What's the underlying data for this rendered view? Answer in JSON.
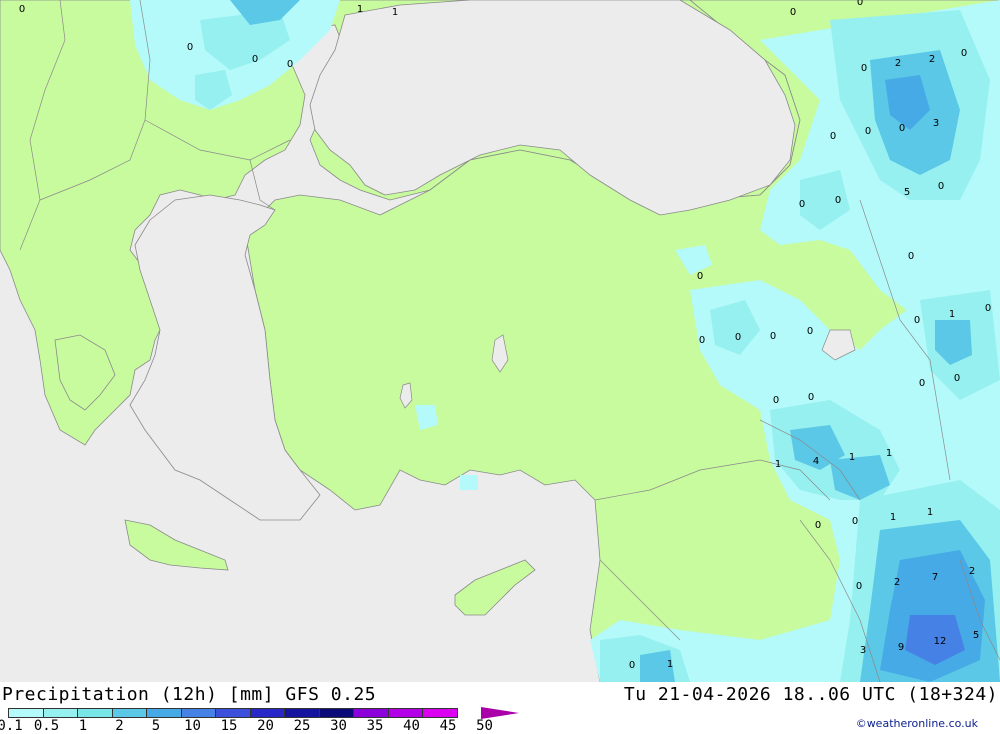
{
  "title": "Precipitation (12h) [mm] GFS 0.25",
  "valid_time": "Tu 21-04-2026 18..06 UTC (18+324)",
  "credit": "©weatheronline.co.uk",
  "colors": {
    "land": "#c8fa9e",
    "sea": "#ececec",
    "border": "#8a8a8a"
  },
  "legend": {
    "labels": [
      "0.1",
      "0.5",
      "1",
      "2",
      "5",
      "10",
      "15",
      "20",
      "25",
      "30",
      "35",
      "40",
      "45",
      "50"
    ],
    "colors": [
      "#b4fafa",
      "#96f0f0",
      "#78e6e6",
      "#5ac8e6",
      "#46aae6",
      "#4682e6",
      "#3c50dc",
      "#2828c8",
      "#1414a0",
      "#0a0a78",
      "#8c00dc",
      "#b400e6",
      "#dc00f0",
      "#aa00aa"
    ]
  },
  "values": [
    {
      "text": "0"
    },
    {
      "text": "1"
    },
    {
      "text": "1"
    },
    {
      "text": "0"
    },
    {
      "text": "0"
    },
    {
      "text": "0"
    },
    {
      "text": "0"
    },
    {
      "text": "0"
    },
    {
      "text": "2"
    },
    {
      "text": "0"
    },
    {
      "text": "0"
    },
    {
      "text": "2"
    },
    {
      "text": "0"
    },
    {
      "text": "0"
    },
    {
      "text": "0"
    },
    {
      "text": "3"
    },
    {
      "text": "5"
    },
    {
      "text": "0"
    },
    {
      "text": "0"
    },
    {
      "text": "0"
    },
    {
      "text": "0"
    },
    {
      "text": "0"
    },
    {
      "text": "0"
    },
    {
      "text": "1"
    },
    {
      "text": "0"
    },
    {
      "text": "0"
    },
    {
      "text": "0"
    },
    {
      "text": "0"
    },
    {
      "text": "0"
    },
    {
      "text": "0"
    },
    {
      "text": "0"
    },
    {
      "text": "0"
    },
    {
      "text": "0"
    },
    {
      "text": "1"
    },
    {
      "text": "4"
    },
    {
      "text": "1"
    },
    {
      "text": "1"
    },
    {
      "text": "0"
    },
    {
      "text": "0"
    },
    {
      "text": "1"
    },
    {
      "text": "1"
    },
    {
      "text": "0"
    },
    {
      "text": "2"
    },
    {
      "text": "7"
    },
    {
      "text": "2"
    },
    {
      "text": "3"
    },
    {
      "text": "9"
    },
    {
      "text": "12"
    },
    {
      "text": "5"
    },
    {
      "text": "0"
    },
    {
      "text": "1"
    }
  ]
}
